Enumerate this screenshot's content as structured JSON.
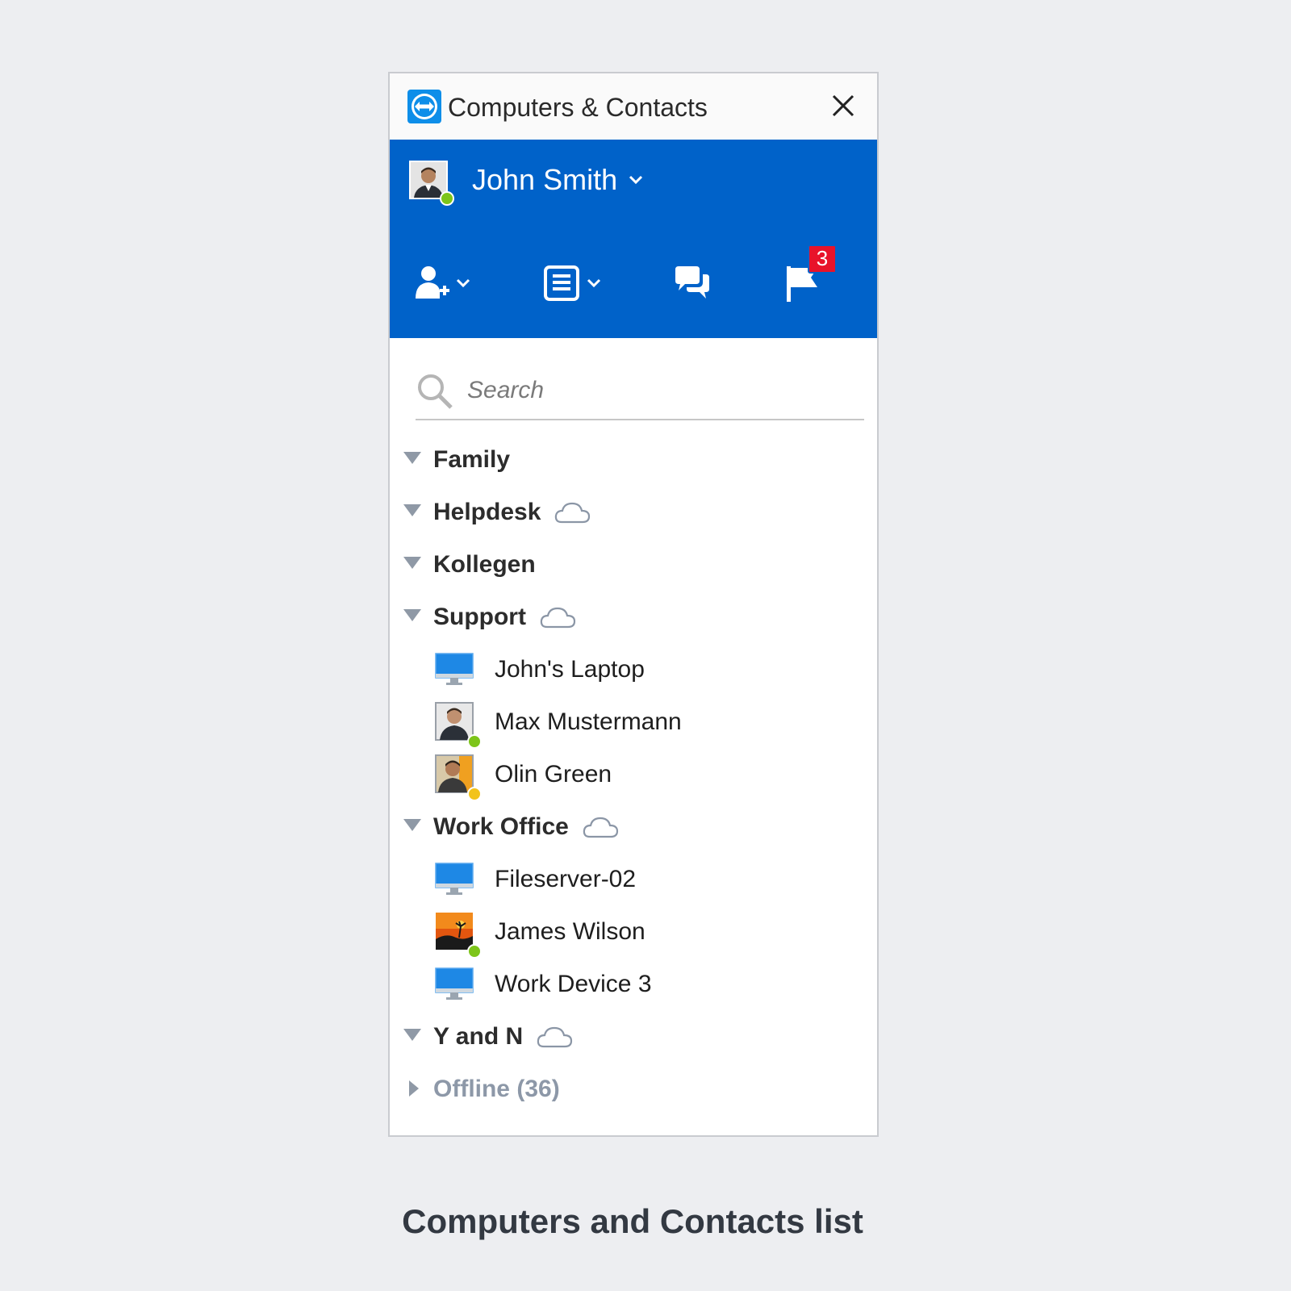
{
  "window": {
    "title": "Computers & Contacts",
    "brand_color": "#0062c9"
  },
  "user": {
    "name": "John Smith",
    "status": "online",
    "status_color": "#7dc51a"
  },
  "toolbar": {
    "items": [
      {
        "icon": "add-contact-icon"
      },
      {
        "icon": "list-view-icon"
      },
      {
        "icon": "chat-icon"
      },
      {
        "icon": "flag-icon",
        "badge": "3"
      }
    ]
  },
  "search": {
    "placeholder": "Search"
  },
  "groups": [
    {
      "label": "Family",
      "cloud": false,
      "expanded": true,
      "items": []
    },
    {
      "label": "Helpdesk",
      "cloud": true,
      "expanded": true,
      "items": []
    },
    {
      "label": "Kollegen",
      "cloud": false,
      "expanded": true,
      "items": []
    },
    {
      "label": "Support",
      "cloud": true,
      "expanded": true,
      "items": [
        {
          "label": "John's Laptop",
          "type": "computer"
        },
        {
          "label": "Max Mustermann",
          "type": "contact",
          "status": "online"
        },
        {
          "label": "Olin Green",
          "type": "contact",
          "status": "away"
        }
      ]
    },
    {
      "label": "Work Office",
      "cloud": true,
      "expanded": true,
      "items": [
        {
          "label": "Fileserver-02",
          "type": "computer"
        },
        {
          "label": "James Wilson",
          "type": "contact",
          "status": "online"
        },
        {
          "label": "Work Device 3",
          "type": "computer"
        }
      ]
    },
    {
      "label": "Y and N",
      "cloud": true,
      "expanded": true,
      "items": []
    }
  ],
  "offline": {
    "label": "Offline (36)"
  },
  "caption": "Computers and Contacts list",
  "colors": {
    "online": "#7dc51a",
    "away": "#f2c31b",
    "badge": "#e8132a"
  }
}
